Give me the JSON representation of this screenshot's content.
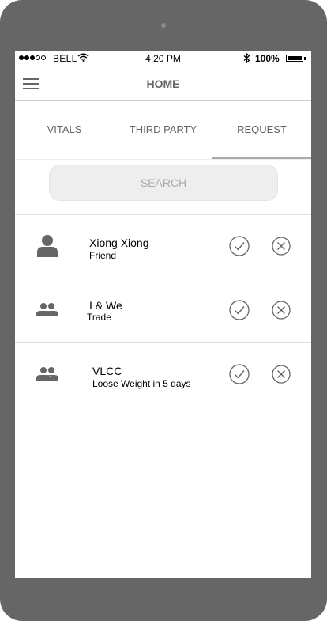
{
  "status_bar": {
    "carrier": "BELL",
    "time": "4:20 PM",
    "battery": "100%",
    "battery_level": 1.0,
    "signal_bars_filled": 3,
    "signal_bars_total": 5
  },
  "nav": {
    "title": "HOME",
    "menu_icon": "hamburger-menu-icon"
  },
  "tabs": [
    {
      "label": "VITALS",
      "active": false
    },
    {
      "label": "THIRD PARTY",
      "active": false
    },
    {
      "label": "REQUEST",
      "active": true
    }
  ],
  "search": {
    "placeholder": "SEARCH",
    "value": ""
  },
  "requests": [
    {
      "name": "Xiong Xiong",
      "subtitle": "Friend",
      "icon": "person-icon"
    },
    {
      "name": "I & We",
      "subtitle": "Trade",
      "icon": "group-icon"
    },
    {
      "name": "VLCC",
      "subtitle": "Loose Weight in 5 days",
      "icon": "group-icon"
    }
  ],
  "actions": {
    "accept_icon": "check-circle-icon",
    "reject_icon": "close-circle-icon"
  },
  "colors": {
    "device_frame": "#666666",
    "text_muted": "#666666",
    "search_bg": "#eeeeee",
    "tab_indicator": "#aaaaaa"
  }
}
